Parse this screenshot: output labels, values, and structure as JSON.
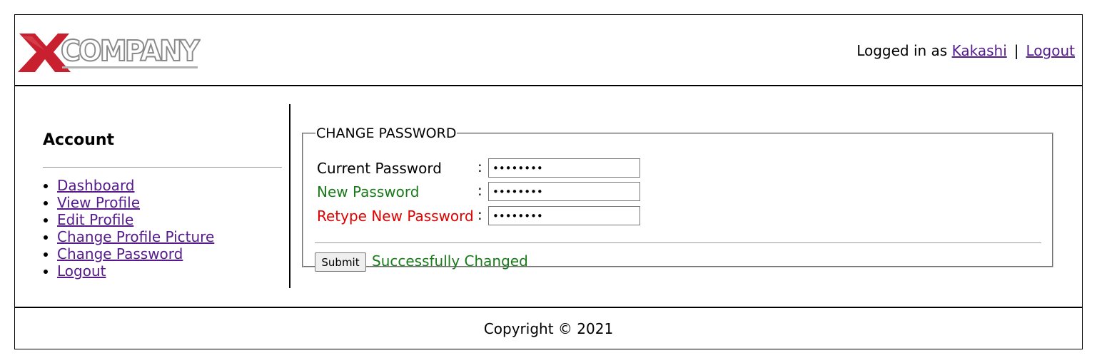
{
  "header": {
    "logo_text": "COMPANY",
    "logo_x": "X",
    "logged_in_prefix": "Logged in as",
    "username": "Kakashi",
    "separator": "|",
    "logout_label": "Logout"
  },
  "sidebar": {
    "title": "Account",
    "items": [
      {
        "label": "Dashboard"
      },
      {
        "label": "View Profile"
      },
      {
        "label": "Edit Profile"
      },
      {
        "label": "Change Profile Picture"
      },
      {
        "label": "Change Password"
      },
      {
        "label": "Logout"
      }
    ]
  },
  "form": {
    "legend": "CHANGE PASSWORD",
    "fields": [
      {
        "label": "Current Password",
        "colon": ":",
        "value": "••••••••",
        "color": "#000000"
      },
      {
        "label": "New Password",
        "colon": ":",
        "value": "••••••••",
        "color": "#1a7a1a"
      },
      {
        "label": "Retype New Password",
        "colon": ":",
        "value": "••••••••",
        "color": "#e00000"
      }
    ],
    "submit_label": "Submit",
    "status": "Successfully Changed",
    "status_color": "#1a7a1a"
  },
  "footer": {
    "copyright": "Copyright © 2021"
  },
  "colors": {
    "link": "#551a8b",
    "logo_red": "#c8202e",
    "logo_gray": "#9a9a9a"
  }
}
